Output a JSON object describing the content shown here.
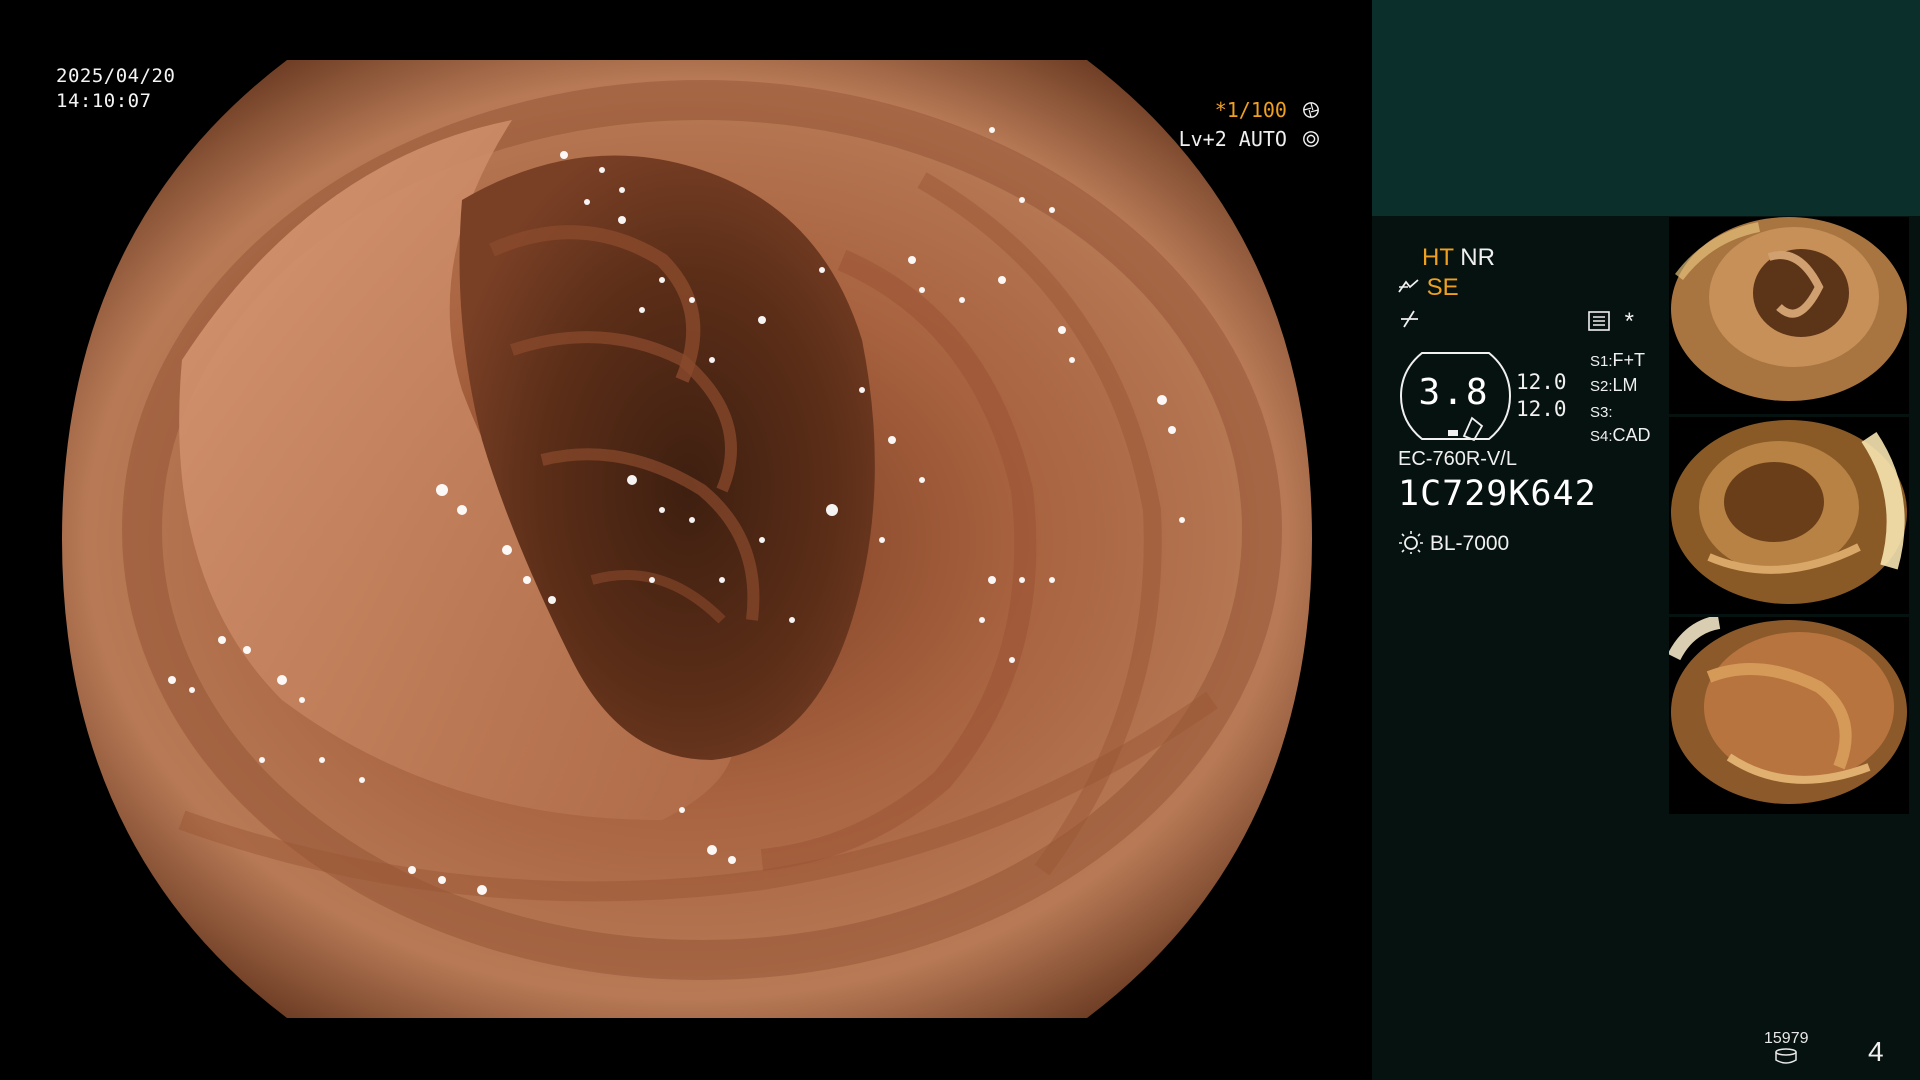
{
  "osd": {
    "date": "2025/04/20",
    "time": "14:10:07",
    "shutter": "*1/100",
    "level": "Lv+2 AUTO"
  },
  "panel": {
    "mode_ht": "HT",
    "mode_nr": "NR",
    "mode_se": "SE",
    "star": "*",
    "gauge_value": "3.8",
    "side_values": [
      "12.0",
      "12.0"
    ],
    "switches": [
      {
        "key": "S1:",
        "value": "F+T"
      },
      {
        "key": "S2:",
        "value": "LM"
      },
      {
        "key": "S3:",
        "value": ""
      },
      {
        "key": "S4:",
        "value": "CAD"
      }
    ],
    "scope_model": "EC-760R-V/L",
    "scope_serial": "1C729K642",
    "light_source": "BL-7000",
    "image_count": "15979",
    "page_number": "4"
  },
  "colors": {
    "accent_orange": "#f0a020",
    "panel_bg": "#06120f",
    "header_band": "#0b302b",
    "mucosa": "#b3714a"
  },
  "icons": [
    "shutter-icon",
    "auto-iris-icon",
    "scope-tool-icon",
    "water-jet-icon",
    "menu-list-icon",
    "light-bulb-icon",
    "storage-icon"
  ]
}
